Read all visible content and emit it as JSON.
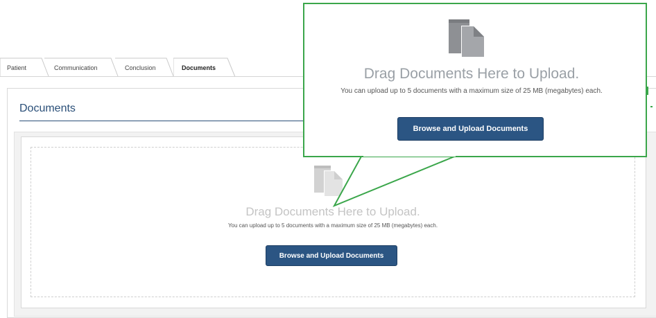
{
  "tabs": [
    {
      "label": "Patient",
      "active": false
    },
    {
      "label": "Communication",
      "active": false
    },
    {
      "label": "Conclusion",
      "active": false
    },
    {
      "label": "Documents",
      "active": true
    }
  ],
  "panel": {
    "title": "Documents"
  },
  "upload": {
    "heading": "Drag Documents Here to Upload.",
    "subtext": "You can upload up to 5 documents with a maximum size of 25 MB (megabytes) each.",
    "button_label": "Browse and Upload Documents"
  },
  "callout": {
    "heading": "Drag Documents Here to Upload.",
    "subtext": "You can upload up to 5 documents with a maximum size of 25 MB (megabytes) each.",
    "button_label": "Browse and Upload Documents"
  },
  "colors": {
    "primary_button": "#2b5583",
    "title_blue": "#2a4f78",
    "callout_border": "#3aa64a",
    "icon_gray_light": "#d0d0d0",
    "icon_gray_dark": "#8e9094"
  },
  "icons": {
    "document": "documents-icon"
  }
}
